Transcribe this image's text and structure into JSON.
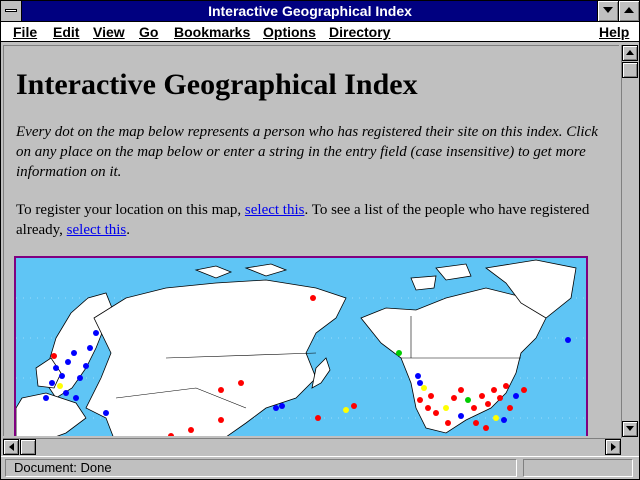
{
  "window": {
    "title": "Interactive Geographical Index"
  },
  "menu": {
    "items": [
      {
        "label": "File"
      },
      {
        "label": "Edit"
      },
      {
        "label": "View"
      },
      {
        "label": "Go"
      },
      {
        "label": "Bookmarks"
      },
      {
        "label": "Options"
      },
      {
        "label": "Directory"
      },
      {
        "label": "Help"
      }
    ]
  },
  "page": {
    "heading": "Interactive Geographical Index",
    "intro": "Every dot on the map below represents a person who has registered their site on this index. Click on any place on the map below or enter a string in the entry field (case insensitive) to get more information on it.",
    "register_prefix": "To register your location on this map, ",
    "register_link": "select this",
    "register_middle": ". To see a list of the people who have registered already, ",
    "list_link": "select this",
    "register_suffix": "."
  },
  "map": {
    "ocean_color": "#5fc5f5",
    "land_color": "#ffffff",
    "dot_colors": {
      "red": "#ff0000",
      "blue": "#0000ff",
      "green": "#00cc00",
      "yellow": "#ffff00"
    }
  },
  "status": {
    "text": "Document: Done"
  }
}
